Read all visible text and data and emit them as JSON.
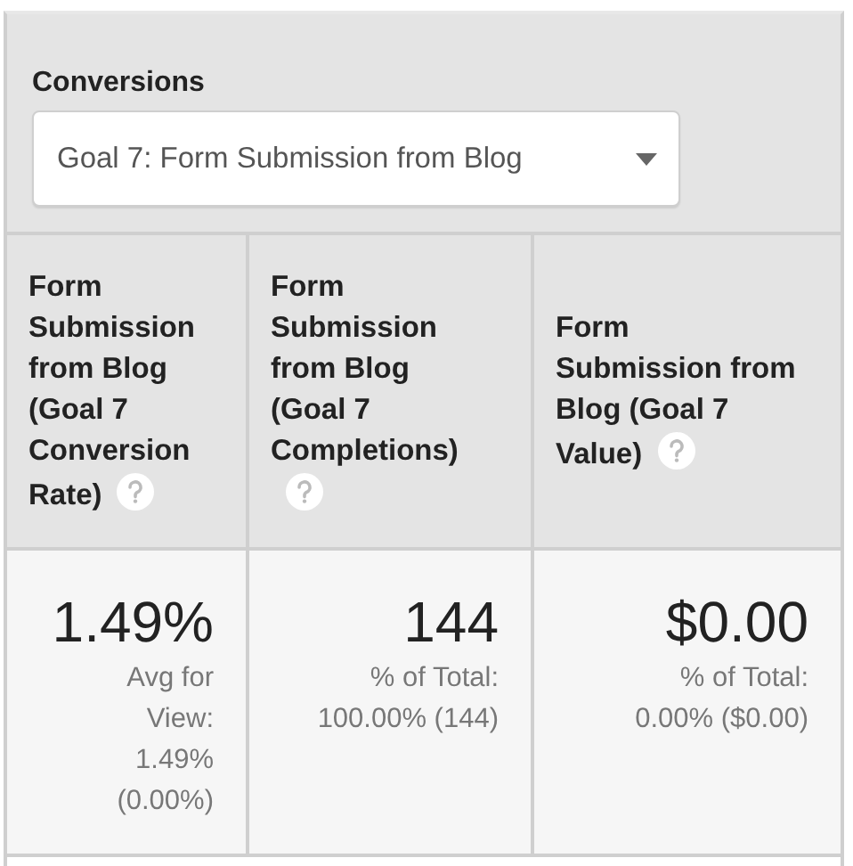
{
  "conversions": {
    "label": "Conversions",
    "dropdown": {
      "value": "Goal 7: Form Submission from Blog"
    }
  },
  "columns": [
    {
      "header": "Form Submission from Blog (Goal 7 Conversion Rate)",
      "value": "1.49%",
      "comparison": "Avg for View: 1.49% (0.00%)"
    },
    {
      "header": "Form Submission from Blog (Goal 7 Completions)",
      "value": "144",
      "comparison": "% of Total: 100.00% (144)"
    },
    {
      "header": "Form Submission from Blog (Goal 7 Value)",
      "value": "$0.00",
      "comparison": "% of Total: 0.00% ($0.00)"
    }
  ]
}
